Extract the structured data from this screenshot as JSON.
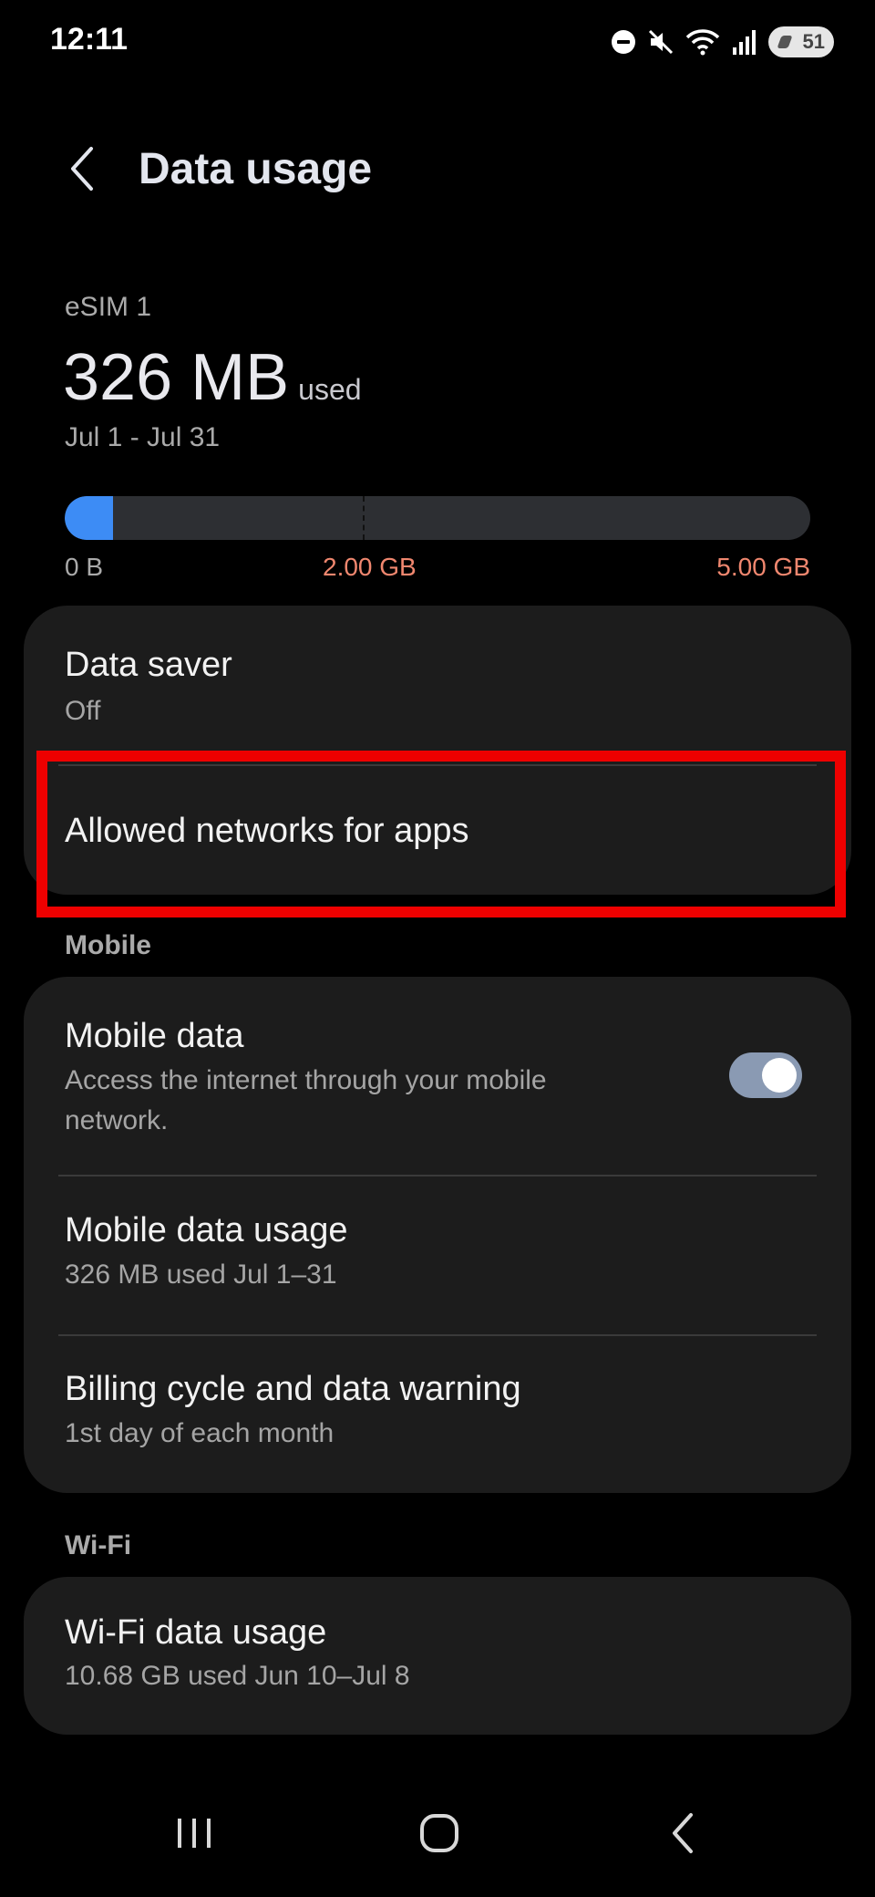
{
  "status_bar": {
    "time": "12:11",
    "battery_level": "51",
    "icons": [
      "do-not-disturb-icon",
      "mute-icon",
      "wifi-icon",
      "signal-icon",
      "battery-icon"
    ]
  },
  "header": {
    "back_icon": "chevron-left-icon",
    "title": "Data usage"
  },
  "summary": {
    "sim_label": "eSIM 1",
    "usage_value": "326 MB",
    "usage_suffix": "used",
    "period": "Jul 1 - Jul 31",
    "progress_fraction": 0.065,
    "warning_fraction": 0.4,
    "tick_min": "0 B",
    "tick_warning": "2.00 GB",
    "tick_limit": "5.00 GB",
    "bar_color": "#3d8cf5",
    "warning_color": "#f0876f"
  },
  "general": {
    "data_saver": {
      "title": "Data saver",
      "subtitle": "Off"
    },
    "allowed_networks": {
      "title": "Allowed networks for apps"
    }
  },
  "mobile": {
    "section_label": "Mobile",
    "mobile_data": {
      "title": "Mobile data",
      "subtitle_line1": "Access the internet through your mobile",
      "subtitle_line2": "network.",
      "enabled": true
    },
    "mobile_data_usage": {
      "title": "Mobile data usage",
      "subtitle": "326 MB used Jul 1–31"
    },
    "billing_cycle": {
      "title": "Billing cycle and data warning",
      "subtitle": "1st day of each month"
    }
  },
  "wifi": {
    "section_label": "Wi-Fi",
    "wifi_data_usage": {
      "title": "Wi-Fi data usage",
      "subtitle": "10.68 GB used Jun 10–Jul 8"
    }
  },
  "highlight_color": "#ee0000",
  "nav_bar": {
    "icons": [
      "recent-apps-icon",
      "home-icon",
      "back-icon"
    ]
  }
}
